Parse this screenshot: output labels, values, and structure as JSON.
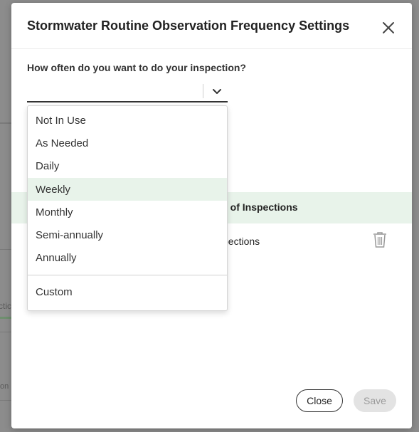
{
  "modal": {
    "title": "Stormwater Routine Observation Frequency Settings",
    "question": "How often do you want to do your inspection?",
    "select_value": "",
    "table_header_fragment": "ber of Inspections",
    "row_fragment": "spections",
    "close_label": "Close",
    "save_label": "Save"
  },
  "dropdown": {
    "options": [
      "Not In Use",
      "As Needed",
      "Daily",
      "Weekly",
      "Monthly",
      "Semi-annually",
      "Annually"
    ],
    "highlighted": "Weekly",
    "custom_label": "Custom"
  },
  "background": {
    "fragment_1": "ctic",
    "fragment_2": "on"
  },
  "colors": {
    "highlight": "#e8f3ea",
    "save_disabled_bg": "#e3e3e3"
  }
}
